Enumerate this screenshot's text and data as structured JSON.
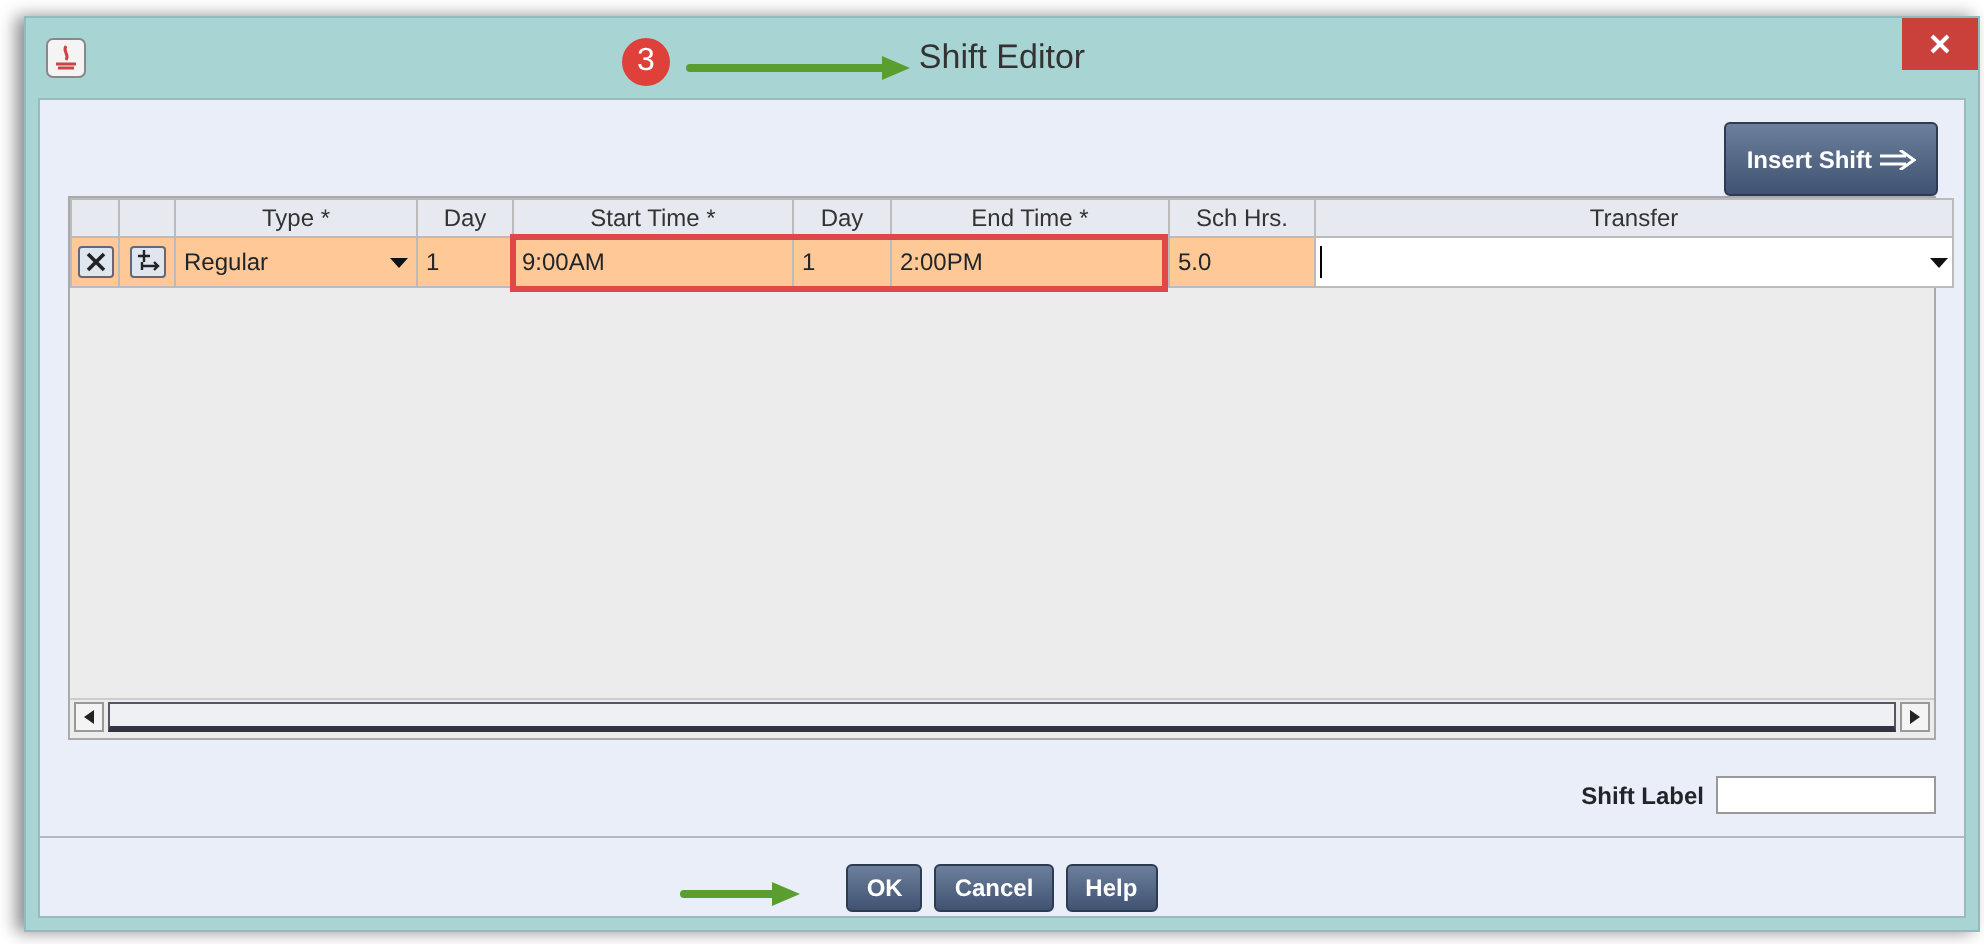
{
  "window": {
    "title": "Shift Editor"
  },
  "annotation": {
    "step": "3",
    "highlight_times": true
  },
  "insert_button": "Insert Shift",
  "table": {
    "columns": [
      "Type *",
      "Day",
      "Start Time *",
      "Day",
      "End Time *",
      "Sch Hrs.",
      "Transfer"
    ],
    "rows": [
      {
        "selected": true,
        "type": "Regular",
        "start_day": "1",
        "start_time": "9:00AM",
        "end_day": "1",
        "end_time": "2:00PM",
        "sch_hrs": "5.0"
      }
    ]
  },
  "shift_label": {
    "label": "Shift Label"
  },
  "buttons": [
    "OK",
    "Cancel",
    "Help"
  ]
}
